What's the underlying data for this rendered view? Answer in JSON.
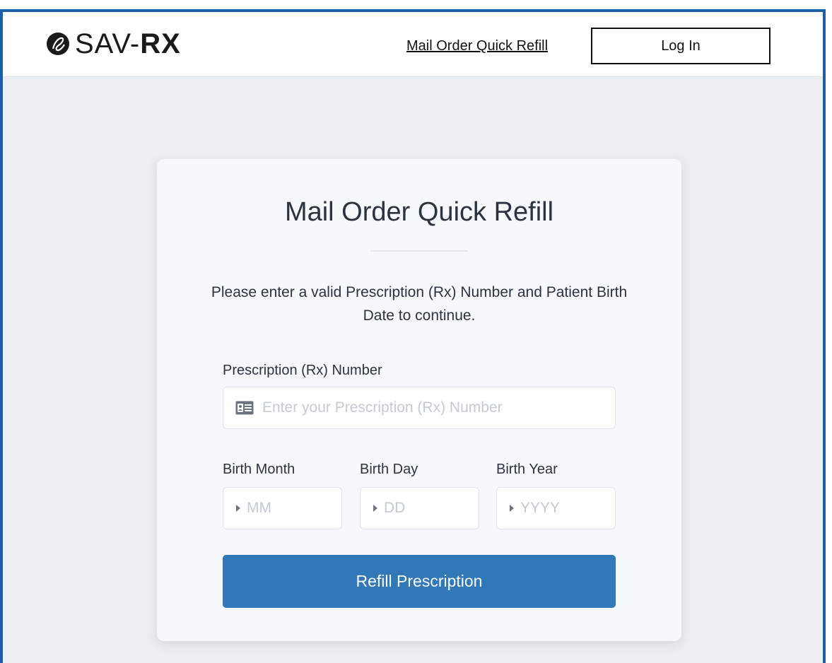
{
  "header": {
    "logo_text_light": "SAV-",
    "logo_text_bold": "RX",
    "nav_link": "Mail Order Quick Refill",
    "login_label": "Log In"
  },
  "card": {
    "title": "Mail Order Quick Refill",
    "description": "Please enter a valid Prescription (Rx) Number and Patient Birth Date to continue.",
    "rx_label": "Prescription (Rx) Number",
    "rx_placeholder": "Enter your Prescription (Rx) Number",
    "birth_month_label": "Birth Month",
    "birth_month_placeholder": "MM",
    "birth_day_label": "Birth Day",
    "birth_day_placeholder": "DD",
    "birth_year_label": "Birth Year",
    "birth_year_placeholder": "YYYY",
    "submit_label": "Refill Prescription"
  },
  "colors": {
    "frame_border": "#1a5fa8",
    "background": "#ebeef3",
    "button": "#3078b8"
  },
  "icons": [
    "logo-mark-icon",
    "id-card-icon",
    "caret-right-icon"
  ]
}
